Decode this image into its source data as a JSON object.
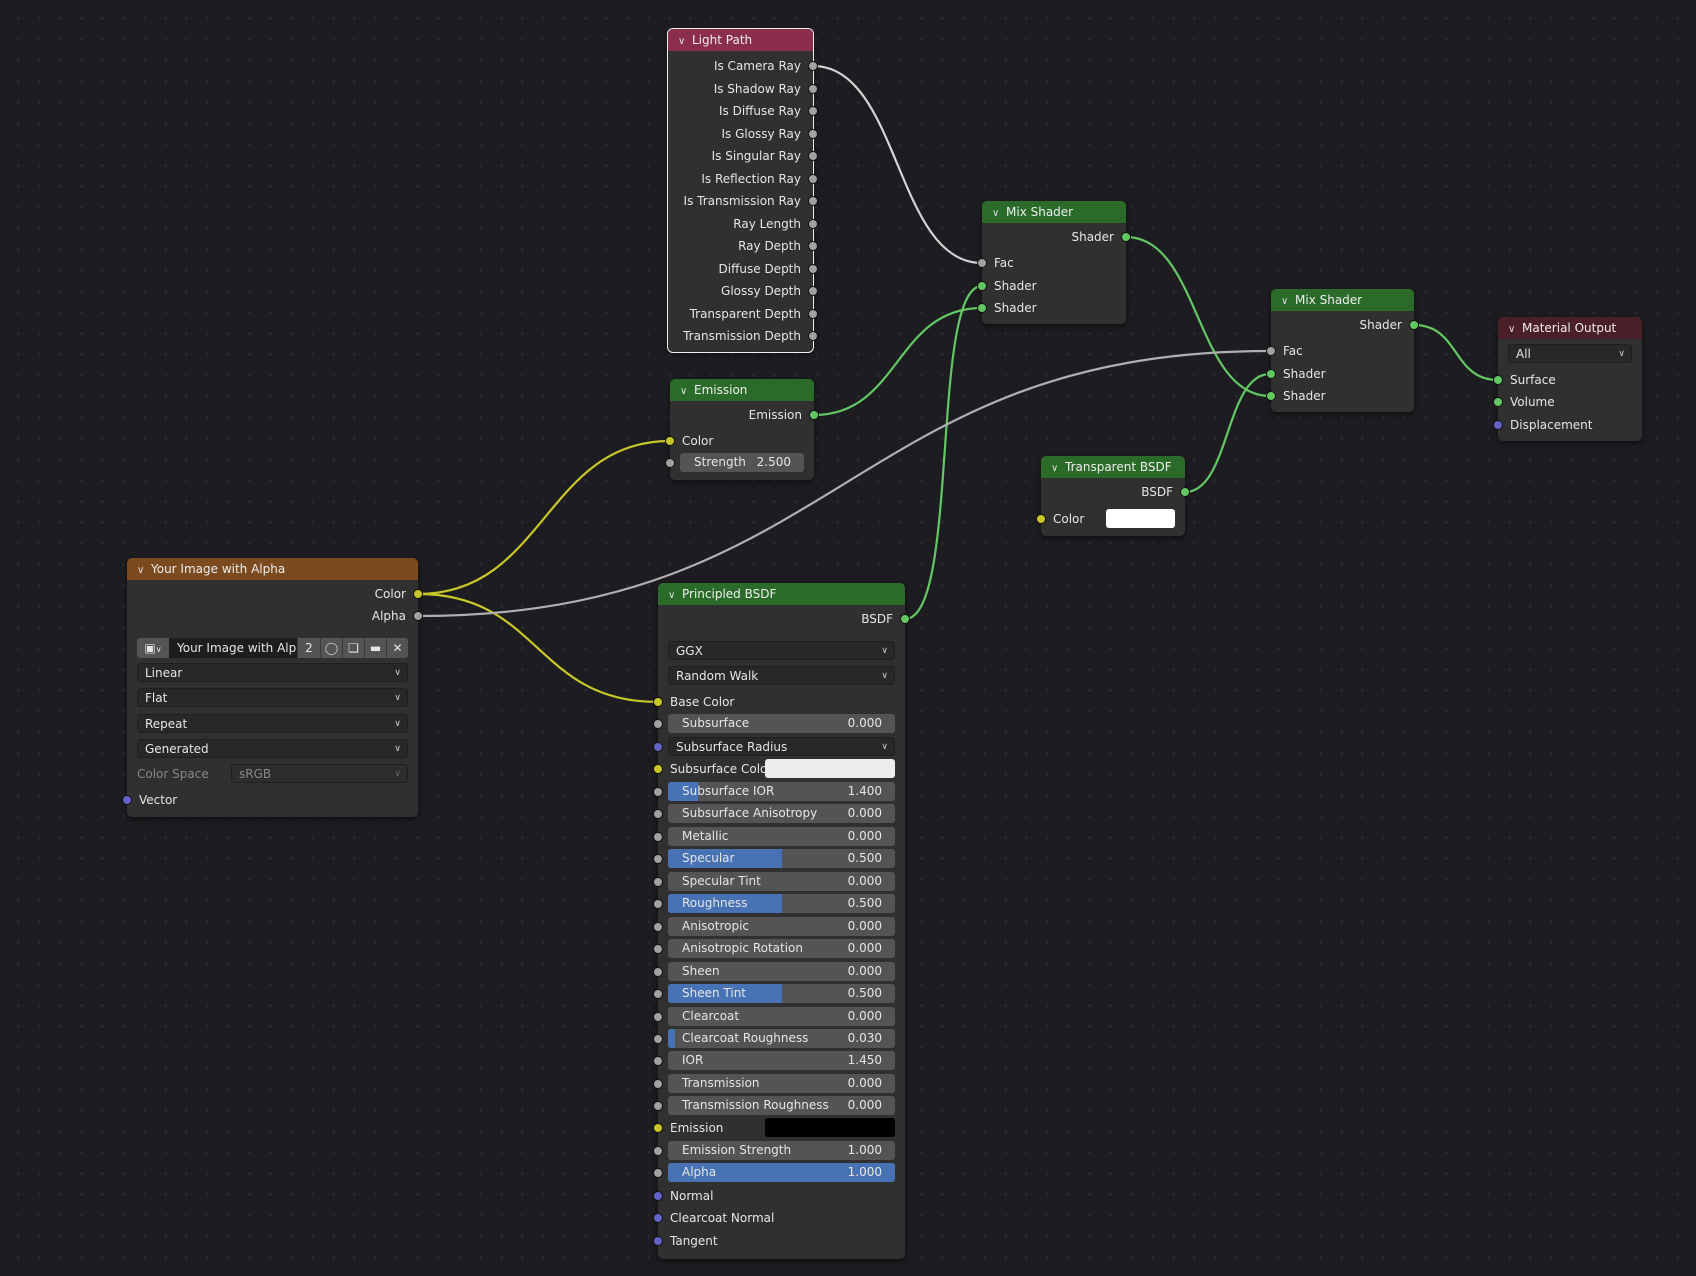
{
  "colors": {
    "canvas_bg": "#1d1d21",
    "node_bg": "#303030",
    "header_input": "#8b2e4b",
    "header_shader": "#2a6b2a",
    "header_texture": "#7b4a1e",
    "header_output": "#4b1f28",
    "slider_fill": "#4772b3",
    "socket_float": "#a1a1a1",
    "socket_shader": "#63c763",
    "socket_color": "#c7c729",
    "socket_vector": "#6363c7"
  },
  "nodes": {
    "light_path": {
      "title": "Light Path",
      "outputs": [
        "Is Camera Ray",
        "Is Shadow Ray",
        "Is Diffuse Ray",
        "Is Glossy Ray",
        "Is Singular Ray",
        "Is Reflection Ray",
        "Is Transmission Ray",
        "Ray Length",
        "Ray Depth",
        "Diffuse Depth",
        "Glossy Depth",
        "Transparent Depth",
        "Transmission Depth"
      ]
    },
    "emission": {
      "title": "Emission",
      "output": "Emission",
      "color_label": "Color",
      "strength_label": "Strength",
      "strength_value": "2.500"
    },
    "image": {
      "title": "Your Image with Alpha",
      "outputs": [
        "Color",
        "Alpha"
      ],
      "image_name": "Your Image with Alpha",
      "users": "2",
      "interpolation": "Linear",
      "projection": "Flat",
      "extension": "Repeat",
      "source": "Generated",
      "color_space_label": "Color Space",
      "color_space_value": "sRGB",
      "vector_label": "Vector"
    },
    "principled": {
      "title": "Principled BSDF",
      "output": "BSDF",
      "distribution": "GGX",
      "subsurface_method": "Random Walk",
      "base_color_label": "Base Color",
      "subsurface": {
        "label": "Subsurface",
        "value": "0.000",
        "fraction": 0
      },
      "subsurface_radius": "Subsurface Radius",
      "subsurface_color_label": "Subsurface Colo",
      "sliders": [
        {
          "label": "Subsurface IOR",
          "value": "1.400",
          "fraction": 0.13
        },
        {
          "label": "Subsurface Anisotropy",
          "value": "0.000",
          "fraction": 0
        },
        {
          "label": "Metallic",
          "value": "0.000",
          "fraction": 0
        },
        {
          "label": "Specular",
          "value": "0.500",
          "fraction": 0.5
        },
        {
          "label": "Specular Tint",
          "value": "0.000",
          "fraction": 0
        },
        {
          "label": "Roughness",
          "value": "0.500",
          "fraction": 0.5
        },
        {
          "label": "Anisotropic",
          "value": "0.000",
          "fraction": 0
        },
        {
          "label": "Anisotropic Rotation",
          "value": "0.000",
          "fraction": 0
        },
        {
          "label": "Sheen",
          "value": "0.000",
          "fraction": 0
        },
        {
          "label": "Sheen Tint",
          "value": "0.500",
          "fraction": 0.5
        },
        {
          "label": "Clearcoat",
          "value": "0.000",
          "fraction": 0
        },
        {
          "label": "Clearcoat Roughness",
          "value": "0.030",
          "fraction": 0.03
        },
        {
          "label": "IOR",
          "value": "1.450",
          "fraction": 0
        },
        {
          "label": "Transmission",
          "value": "0.000",
          "fraction": 0
        },
        {
          "label": "Transmission Roughness",
          "value": "0.000",
          "fraction": 0
        }
      ],
      "emission_label": "Emission",
      "emission_strength": {
        "label": "Emission Strength",
        "value": "1.000",
        "fraction": 0
      },
      "alpha": {
        "label": "Alpha",
        "value": "1.000",
        "fraction": 1
      },
      "vector_inputs": [
        "Normal",
        "Clearcoat Normal",
        "Tangent"
      ]
    },
    "mix1": {
      "title": "Mix Shader",
      "output": "Shader",
      "inputs": [
        "Fac",
        "Shader",
        "Shader"
      ]
    },
    "mix2": {
      "title": "Mix Shader",
      "output": "Shader",
      "inputs": [
        "Fac",
        "Shader",
        "Shader"
      ]
    },
    "transparent": {
      "title": "Transparent BSDF",
      "output": "BSDF",
      "color_label": "Color"
    },
    "material_output": {
      "title": "Material Output",
      "target": "All",
      "inputs": [
        "Surface",
        "Volume",
        "Displacement"
      ]
    }
  },
  "links": [
    {
      "from": "Light Path.Is Camera Ray",
      "to": "Mix Shader.Fac",
      "color": "#d0d0d0"
    },
    {
      "from": "Emission.Emission",
      "to": "Mix Shader.Shader (2)",
      "color": "#63c763"
    },
    {
      "from": "Principled BSDF.BSDF",
      "to": "Mix Shader.Shader (1)",
      "color": "#63c763"
    },
    {
      "from": "Mix Shader.Shader",
      "to": "Mix Shader (2).Shader (2)",
      "color": "#63c763"
    },
    {
      "from": "Transparent BSDF.BSDF",
      "to": "Mix Shader (2).Shader (1)",
      "color": "#63c763"
    },
    {
      "from": "Mix Shader (2).Shader",
      "to": "Material Output.Surface",
      "color": "#63c763"
    },
    {
      "from": "Image.Color",
      "to": "Emission.Color",
      "color": "#c7c729"
    },
    {
      "from": "Image.Color",
      "to": "Principled BSDF.Base Color",
      "color": "#c7c729"
    },
    {
      "from": "Image.Alpha",
      "to": "Mix Shader (2).Fac",
      "color": "#b0b0b0"
    }
  ]
}
